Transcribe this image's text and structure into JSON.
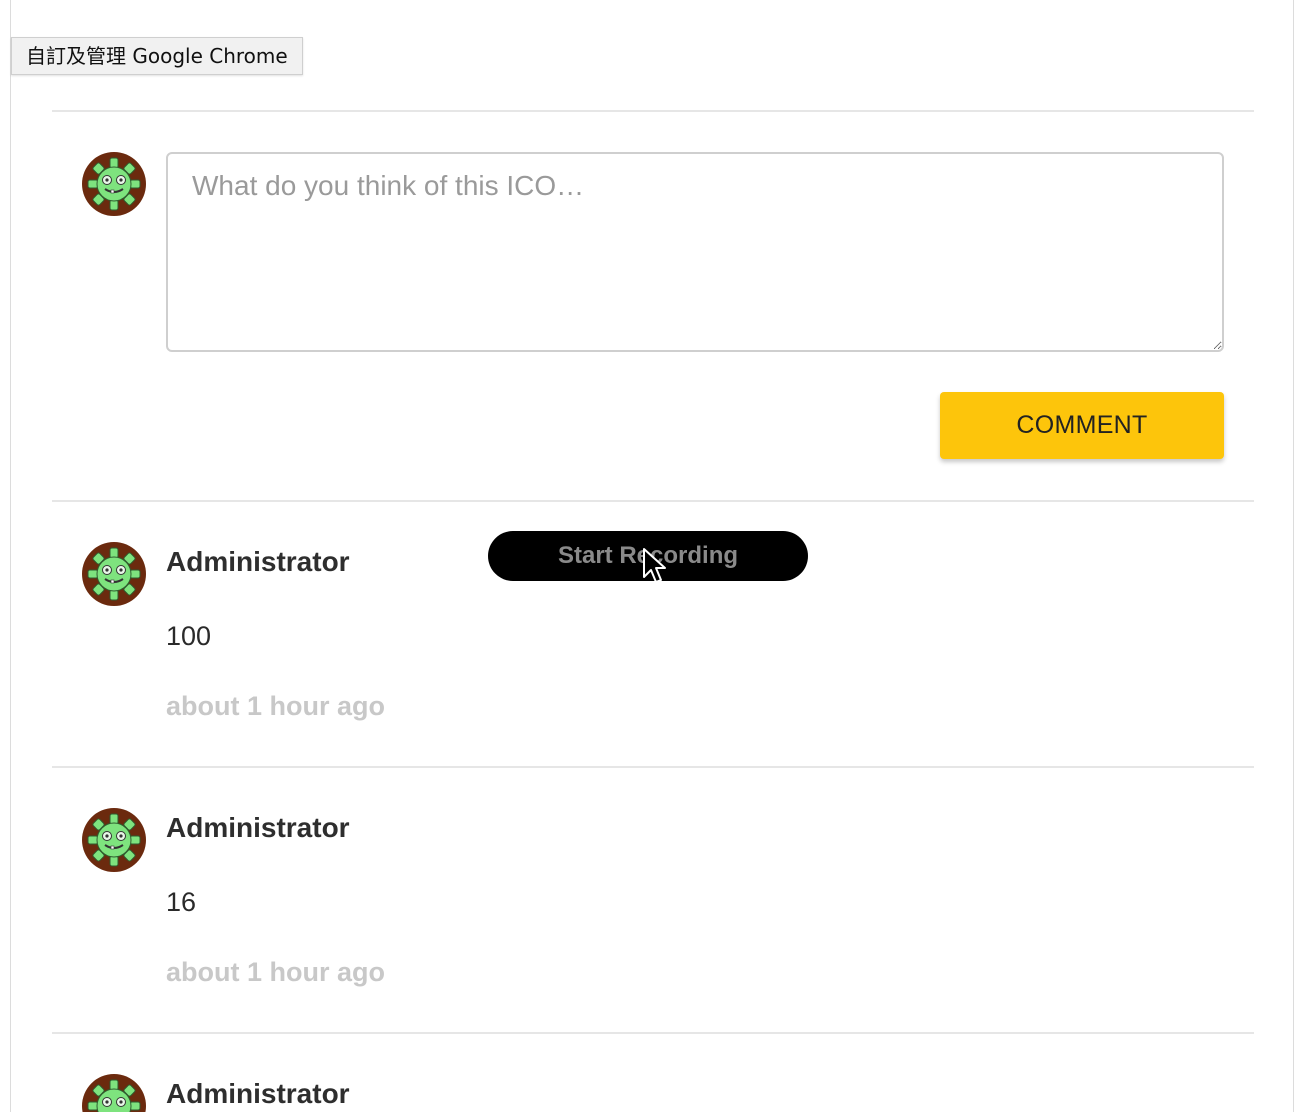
{
  "tooltip": {
    "text": "自訂及管理 Google Chrome"
  },
  "composer": {
    "placeholder": "What do you think of this ICO…",
    "submit_label": "COMMENT"
  },
  "recorder": {
    "label": "Start Recording"
  },
  "comments": [
    {
      "author": "Administrator",
      "body": "100",
      "time": "about 1 hour ago"
    },
    {
      "author": "Administrator",
      "body": "16",
      "time": "about 1 hour ago"
    },
    {
      "author": "Administrator"
    }
  ],
  "colors": {
    "accent_button": "#fdc50b",
    "avatar_ring": "#6b2a0e",
    "avatar_face": "#7ee37e",
    "timestamp": "#c8c8c8",
    "divider": "#e6e6e6"
  },
  "icons": {
    "avatar": "gear-robot-avatar-icon",
    "cursor": "mouse-pointer-icon"
  }
}
